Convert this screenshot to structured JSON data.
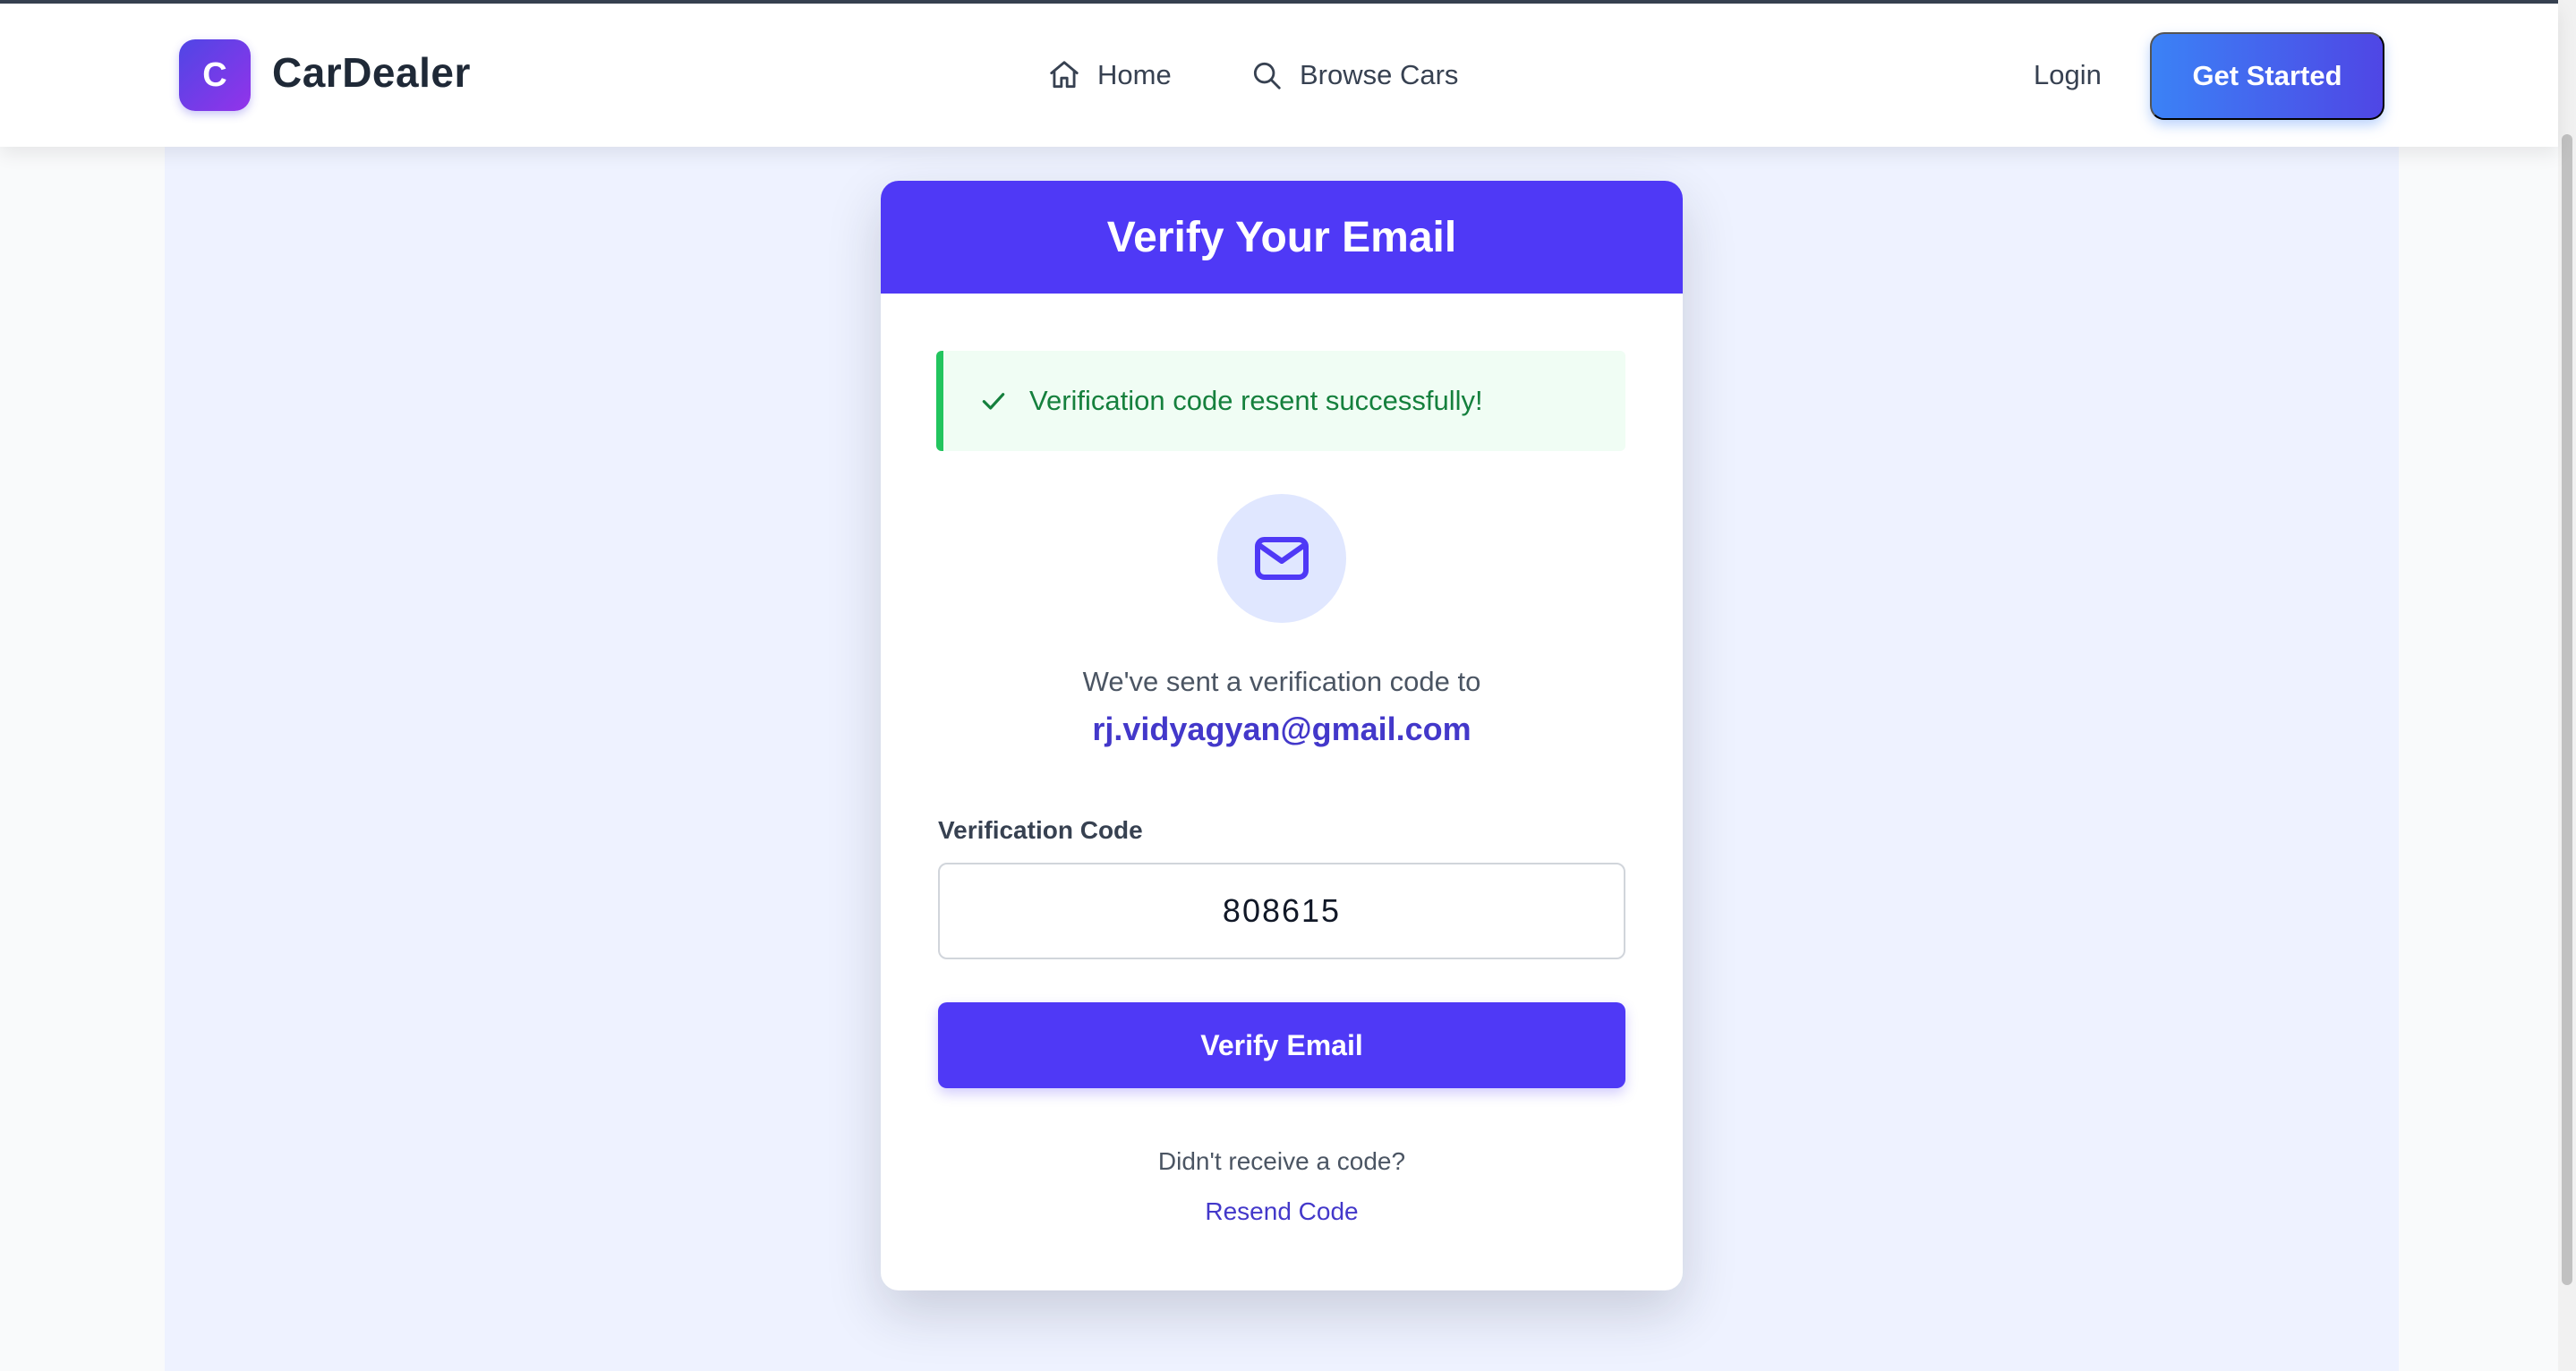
{
  "navbar": {
    "logo_letter": "C",
    "brand": "CarDealer",
    "links": {
      "home": "Home",
      "browse": "Browse Cars"
    },
    "login": "Login",
    "cta": "Get Started"
  },
  "card": {
    "title": "Verify Your Email",
    "alert": "Verification code resent successfully!",
    "sent_message": "We've sent a verification code to",
    "email": "rj.vidyagyan@gmail.com",
    "code_label": "Verification Code",
    "code_value": "808615",
    "verify_button": "Verify Email",
    "no_code_text": "Didn't receive a code?",
    "resend_link": "Resend Code"
  },
  "colors": {
    "primary": "#4f39f6",
    "accent_blue": "#3b82f6",
    "success": "#22c55e",
    "link": "#4338ca"
  },
  "icons": [
    "home-icon",
    "search-icon",
    "check-icon",
    "mail-icon"
  ]
}
